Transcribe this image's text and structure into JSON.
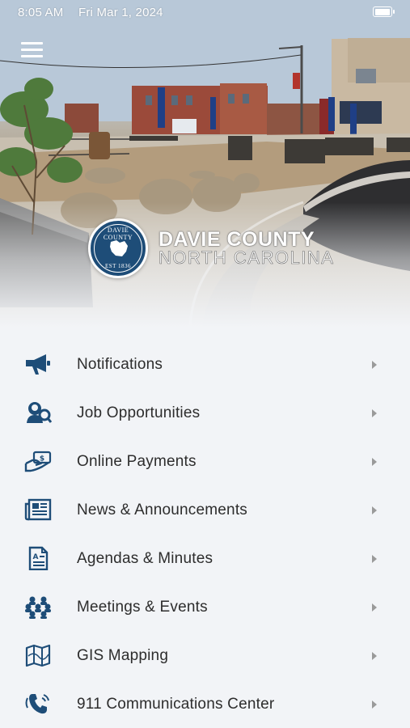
{
  "status_bar": {
    "time": "8:05 AM",
    "date": "Fri Mar 1, 2024"
  },
  "header": {
    "title": "DAVIE COUNTY",
    "subtitle": "NORTH CAROLINA",
    "seal_top": "DAVIE COUNTY",
    "seal_bottom": "EST 1836"
  },
  "colors": {
    "brand": "#1e4d78",
    "text": "#2d2d2d",
    "chevron": "#9a9a9a",
    "background": "#f2f4f7"
  },
  "menu": [
    {
      "label": "Notifications",
      "icon": "megaphone-icon"
    },
    {
      "label": "Job Opportunities",
      "icon": "job-seeker-icon"
    },
    {
      "label": "Online Payments",
      "icon": "payment-hand-icon"
    },
    {
      "label": "News & Announcements",
      "icon": "newspaper-icon"
    },
    {
      "label": "Agendas & Minutes",
      "icon": "document-icon"
    },
    {
      "label": "Meetings & Events",
      "icon": "group-icon"
    },
    {
      "label": "GIS Mapping",
      "icon": "map-icon"
    },
    {
      "label": "911 Communications Center",
      "icon": "emergency-phone-icon"
    }
  ]
}
